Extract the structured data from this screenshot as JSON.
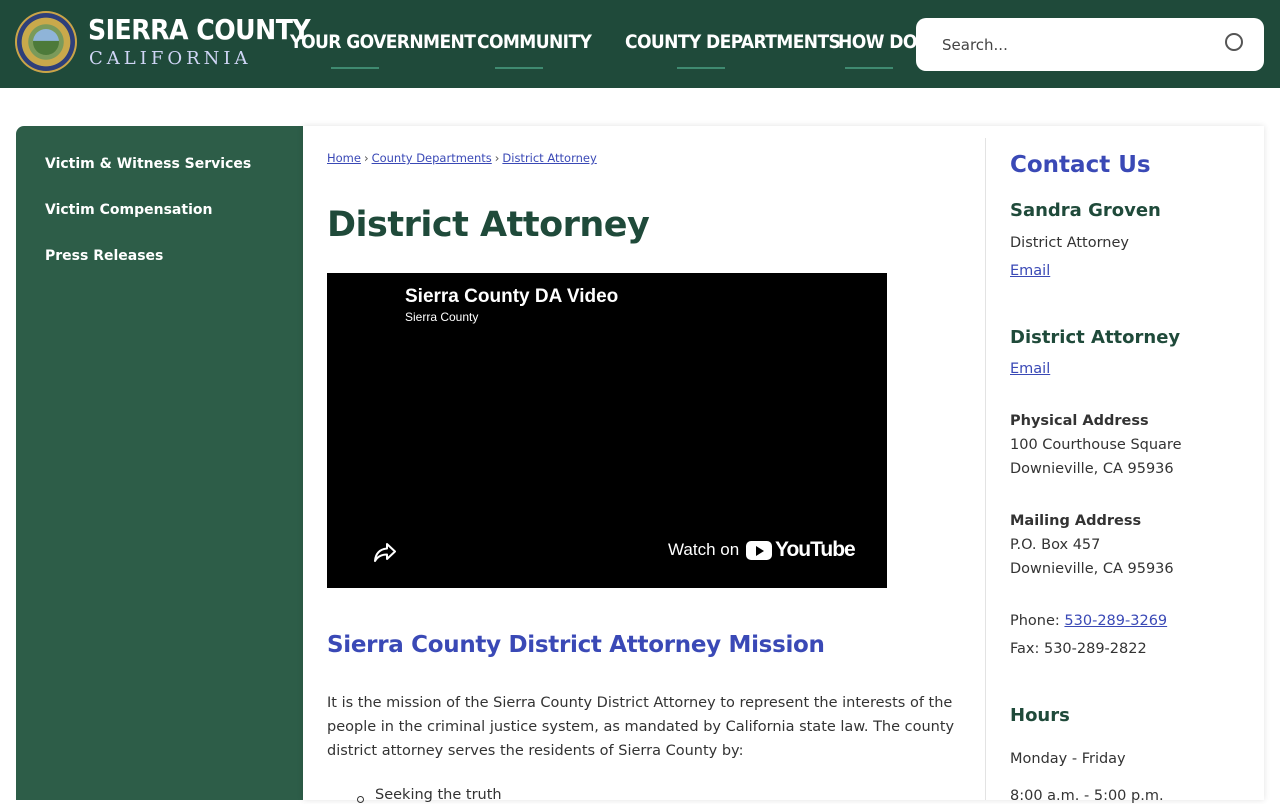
{
  "header": {
    "brand_title": "SIERRA COUNTY",
    "brand_subtitle": "CALIFORNIA",
    "nav": [
      "YOUR GOVERNMENT",
      "COMMUNITY",
      "COUNTY DEPARTMENTS",
      "HOW DO I"
    ],
    "search_placeholder": "Search..."
  },
  "sidebar": {
    "items": [
      "Victim & Witness Services",
      "Victim Compensation",
      "Press Releases"
    ]
  },
  "breadcrumb": {
    "home": "Home",
    "section": "County Departments",
    "current": "District Attorney",
    "separator": "›"
  },
  "main": {
    "title": "District Attorney",
    "video": {
      "title": "Sierra County DA Video",
      "channel": "Sierra County",
      "watch_on": "Watch on",
      "platform": "YouTube"
    },
    "mission_heading": "Sierra County District Attorney Mission",
    "mission_text": "It is the mission of the Sierra County District Attorney to represent the interests of the people in the criminal justice system, as mandated by California state law. The county district attorney serves the residents of Sierra County by:",
    "bullets": [
      "Seeking the truth"
    ]
  },
  "contact": {
    "heading": "Contact Us",
    "person_name": "Sandra Groven",
    "person_title": "District Attorney",
    "person_email": "Email",
    "office_name": "District Attorney",
    "office_email": "Email",
    "physical_label": "Physical Address",
    "physical_line1": "100 Courthouse Square",
    "physical_line2": "Downieville, CA 95936",
    "mailing_label": "Mailing Address",
    "mailing_line1": "P.O. Box 457",
    "mailing_line2": "Downieville, CA 95936",
    "phone_label": "Phone:",
    "phone": "530-289-3269",
    "fax": "Fax: 530-289-2822",
    "hours_heading": "Hours",
    "hours_days": "Monday - Friday",
    "hours_time": "8:00 a.m. - 5:00 p.m."
  },
  "colors": {
    "header_bg": "#1f4a3a",
    "sidebar_bg": "#2d5d48",
    "accent_blue": "#3a49b6",
    "heading_green": "#1f4a3a"
  }
}
